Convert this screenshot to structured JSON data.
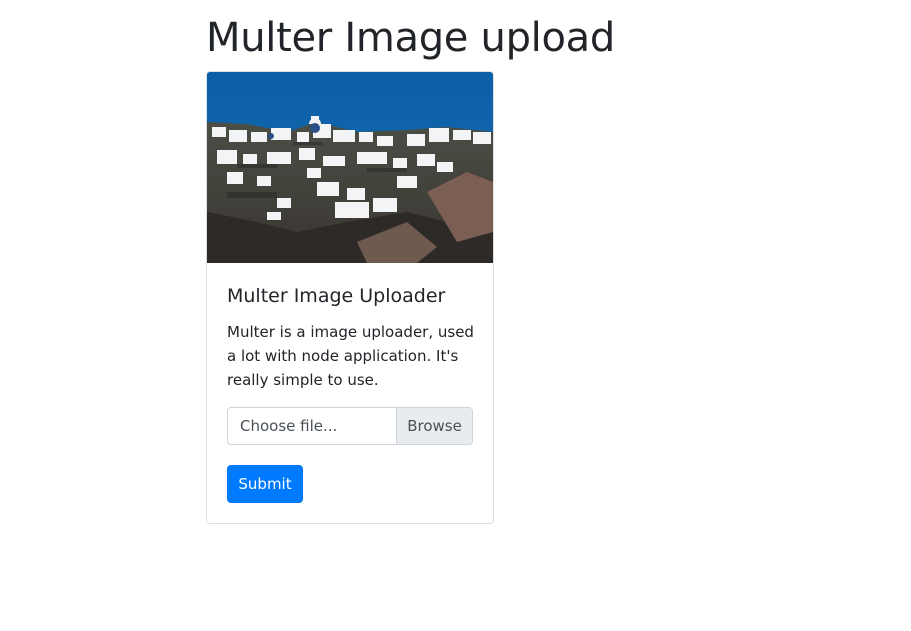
{
  "page": {
    "title": "Multer Image upload"
  },
  "card": {
    "image": "santorini-cliff-village-photo",
    "title": "Multer Image Uploader",
    "text": "Multer is a image uploader, used a lot with node application. It's really simple to use.",
    "file_input": {
      "placeholder": "Choose file...",
      "browse_label": "Browse"
    },
    "submit_label": "Submit"
  },
  "colors": {
    "primary": "#007bff",
    "text": "#212529",
    "input_border": "#ced4da",
    "browse_bg": "#e9ecef"
  }
}
